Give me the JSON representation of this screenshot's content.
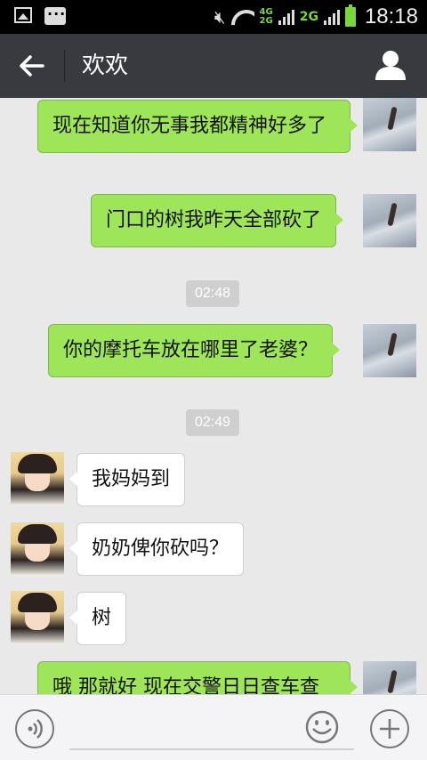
{
  "status_bar": {
    "time": "18:18",
    "net_top": "4G",
    "net_bottom": "2G",
    "net_2g": "2G",
    "icons": [
      "gallery-icon",
      "chat-notification-icon",
      "mute-icon",
      "wifi-icon",
      "signal-icon",
      "battery-icon"
    ]
  },
  "header": {
    "title": "欢欢",
    "back_icon": "back-arrow-icon",
    "profile_icon": "person-icon"
  },
  "messages": [
    {
      "direction": "out",
      "text": "现在知道你无事我都精神好多了"
    },
    {
      "direction": "out",
      "text": "门口的树我昨天全部砍了"
    },
    {
      "type": "time",
      "text": "02:48"
    },
    {
      "direction": "out",
      "text": "你的摩托车放在哪里了老婆？"
    },
    {
      "type": "time",
      "text": "02:49"
    },
    {
      "direction": "in",
      "text": "我妈妈到"
    },
    {
      "direction": "in",
      "text": "奶奶俾你砍吗？"
    },
    {
      "direction": "in",
      "text": "树"
    },
    {
      "direction": "out",
      "text": "哦 那就好 现在交警日日查车查"
    }
  ],
  "input_bar": {
    "value": "",
    "placeholder": "",
    "voice_icon": "voice-icon",
    "emoji_icon": "emoji-icon",
    "plus_icon": "plus-icon"
  },
  "colors": {
    "header_bg": "#393a3f",
    "outgoing_bubble": "#9fe55a",
    "incoming_bubble": "#ffffff",
    "chat_bg": "#e9e9e9"
  }
}
